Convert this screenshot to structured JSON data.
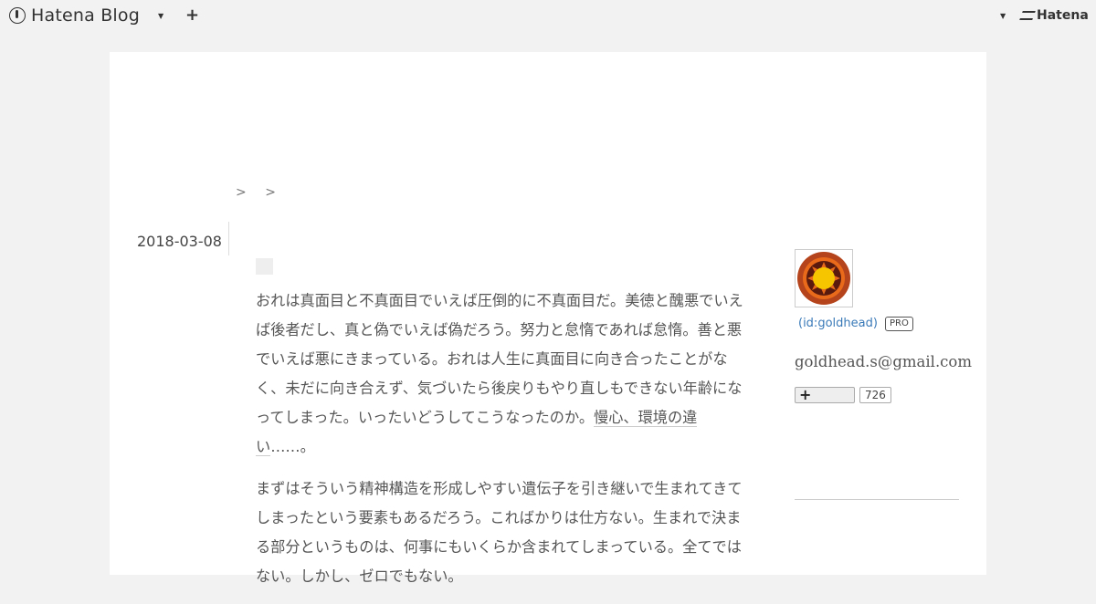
{
  "topbar": {
    "logo_text": "Hatena Blog",
    "add_icon": "plus-icon",
    "brand_text": "Hatena"
  },
  "breadcrumb": [
    ">",
    ">"
  ],
  "entry": {
    "date": "2018-03-08",
    "paragraphs": [
      {
        "text": "おれは真面目と不真面目でいえば圧倒的に不真面目だ。美徳と醜悪でいえば後者だし、真と偽でいえば偽だろう。努力と怠惰であれば怠惰。善と悪でいえば悪にきまっている。おれは人生に真面目に向き合ったことがなく、未だに向き合えず、気づいたら後戻りもやり直しもできない年齢になってしまった。いったいどうしてこうなったのか。",
        "link": "慢心、環境の違い",
        "tail": "……。"
      },
      {
        "text": "まずはそういう精神構造を形成しやすい遺伝子を引き継いで生まれてきてしまったという要素もあるだろう。こればかりは仕方ない。生まれで決まる部分というものは、何事にもいくらか含まれてしまっている。全てではない。しかし、ゼロでもない。"
      }
    ]
  },
  "sidebar": {
    "user_id": "(id:goldhead)",
    "badge": "PRO",
    "email": "goldhead.s@gmail.com",
    "subscriber_count": "726",
    "avatar_colors": {
      "outer": "#b5441c",
      "ring": "#e86a1a",
      "sun": "#f6c500",
      "dark": "#5a1a0e"
    }
  }
}
